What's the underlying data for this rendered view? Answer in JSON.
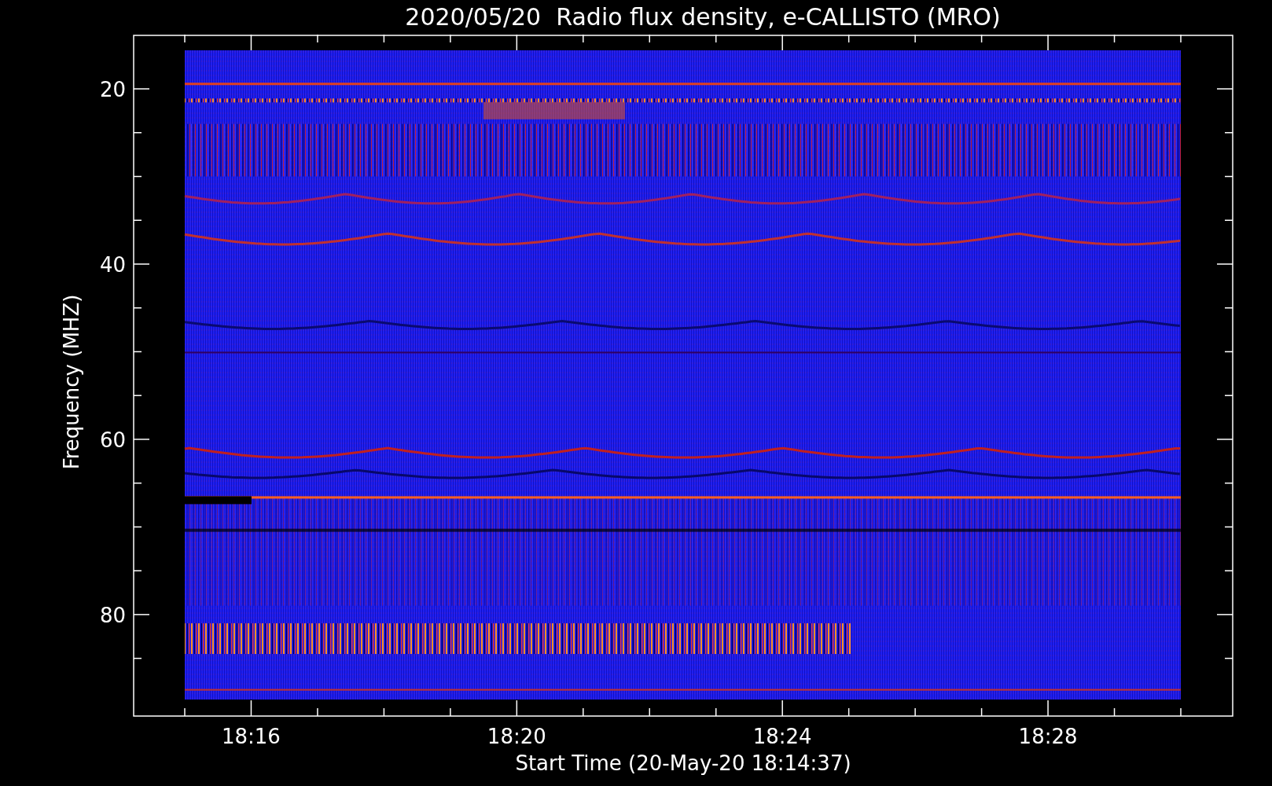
{
  "title": "2020/05/20  Radio flux density, e-CALLISTO (MRO)",
  "y_axis": {
    "label": "Frequency (MHZ)",
    "ticks": [
      "20",
      "40",
      "60",
      "80"
    ]
  },
  "x_axis": {
    "label": "Start Time (20-May-20 18:14:37)",
    "ticks": [
      "18:16",
      "18:20",
      "18:24",
      "18:28"
    ]
  }
}
